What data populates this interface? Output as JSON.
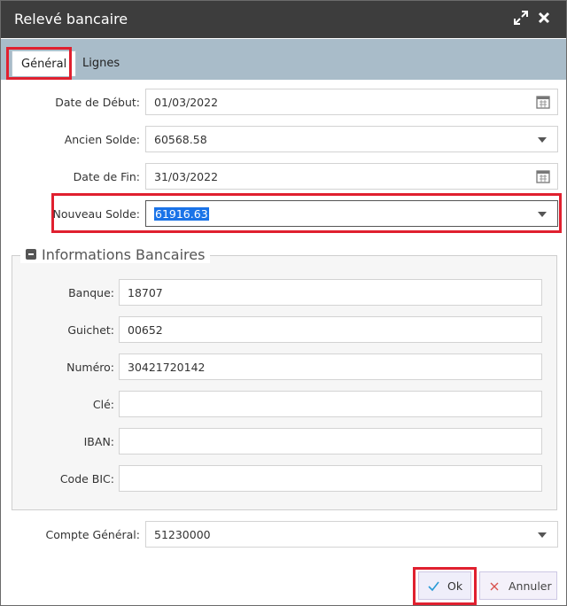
{
  "window": {
    "title": "Relevé bancaire",
    "expand_icon": "expand-icon",
    "close_icon": "close-icon"
  },
  "tabs": [
    {
      "label": "Général"
    },
    {
      "label": "Lignes"
    }
  ],
  "form": {
    "date_debut": {
      "label": "Date de Début:",
      "value": "01/03/2022"
    },
    "ancien_solde": {
      "label": "Ancien Solde:",
      "value": "60568.58"
    },
    "date_fin": {
      "label": "Date de Fin:",
      "value": "31/03/2022"
    },
    "nouveau_solde": {
      "label": "Nouveau Solde:",
      "value": "61916.63"
    },
    "compte_general": {
      "label": "Compte Général:",
      "value": "51230000"
    }
  },
  "bank_info": {
    "legend": "Informations Bancaires",
    "banque": {
      "label": "Banque:",
      "value": "18707"
    },
    "guichet": {
      "label": "Guichet:",
      "value": "00652"
    },
    "numero": {
      "label": "Numéro:",
      "value": "30421720142"
    },
    "cle": {
      "label": "Clé:",
      "value": ""
    },
    "iban": {
      "label": "IBAN:",
      "value": ""
    },
    "code_bic": {
      "label": "Code BIC:",
      "value": ""
    }
  },
  "buttons": {
    "ok": "Ok",
    "cancel": "Annuler"
  },
  "colors": {
    "titlebar": "#3d3d3d",
    "tabbar": "#a9bcc9",
    "highlight": "#e0202f",
    "selection": "#1a73e8"
  }
}
